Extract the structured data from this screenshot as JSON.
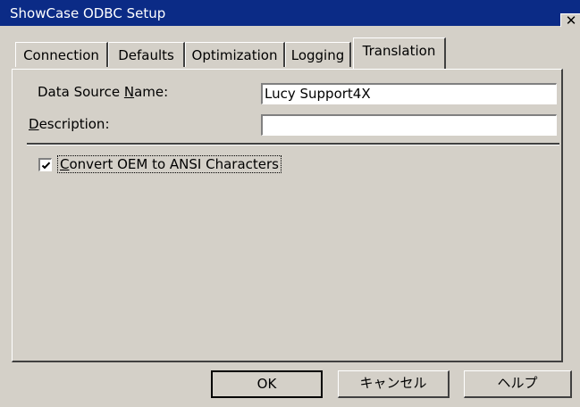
{
  "window": {
    "title": "ShowCase ODBC Setup",
    "close_glyph": "✕"
  },
  "tabs": [
    {
      "label": "Connection",
      "active": false
    },
    {
      "label": "Defaults",
      "active": false
    },
    {
      "label": "Optimization",
      "active": false
    },
    {
      "label": "Logging",
      "active": false
    },
    {
      "label": "Translation",
      "active": true
    }
  ],
  "form": {
    "dsn": {
      "label_pre": "Data Source ",
      "label_key": "N",
      "label_post": "ame:",
      "value": "Lucy Support4X"
    },
    "description": {
      "label_key": "D",
      "label_post": "escription:",
      "value": ""
    }
  },
  "options": {
    "convert_oem": {
      "label_key": "C",
      "label_post": "onvert OEM to ANSI Characters",
      "checked": true
    }
  },
  "buttons": {
    "ok": "OK",
    "cancel": "キャンセル",
    "help": "ヘルプ"
  },
  "colors": {
    "titlebar": "#0b2b86",
    "face": "#d4d0c8"
  }
}
